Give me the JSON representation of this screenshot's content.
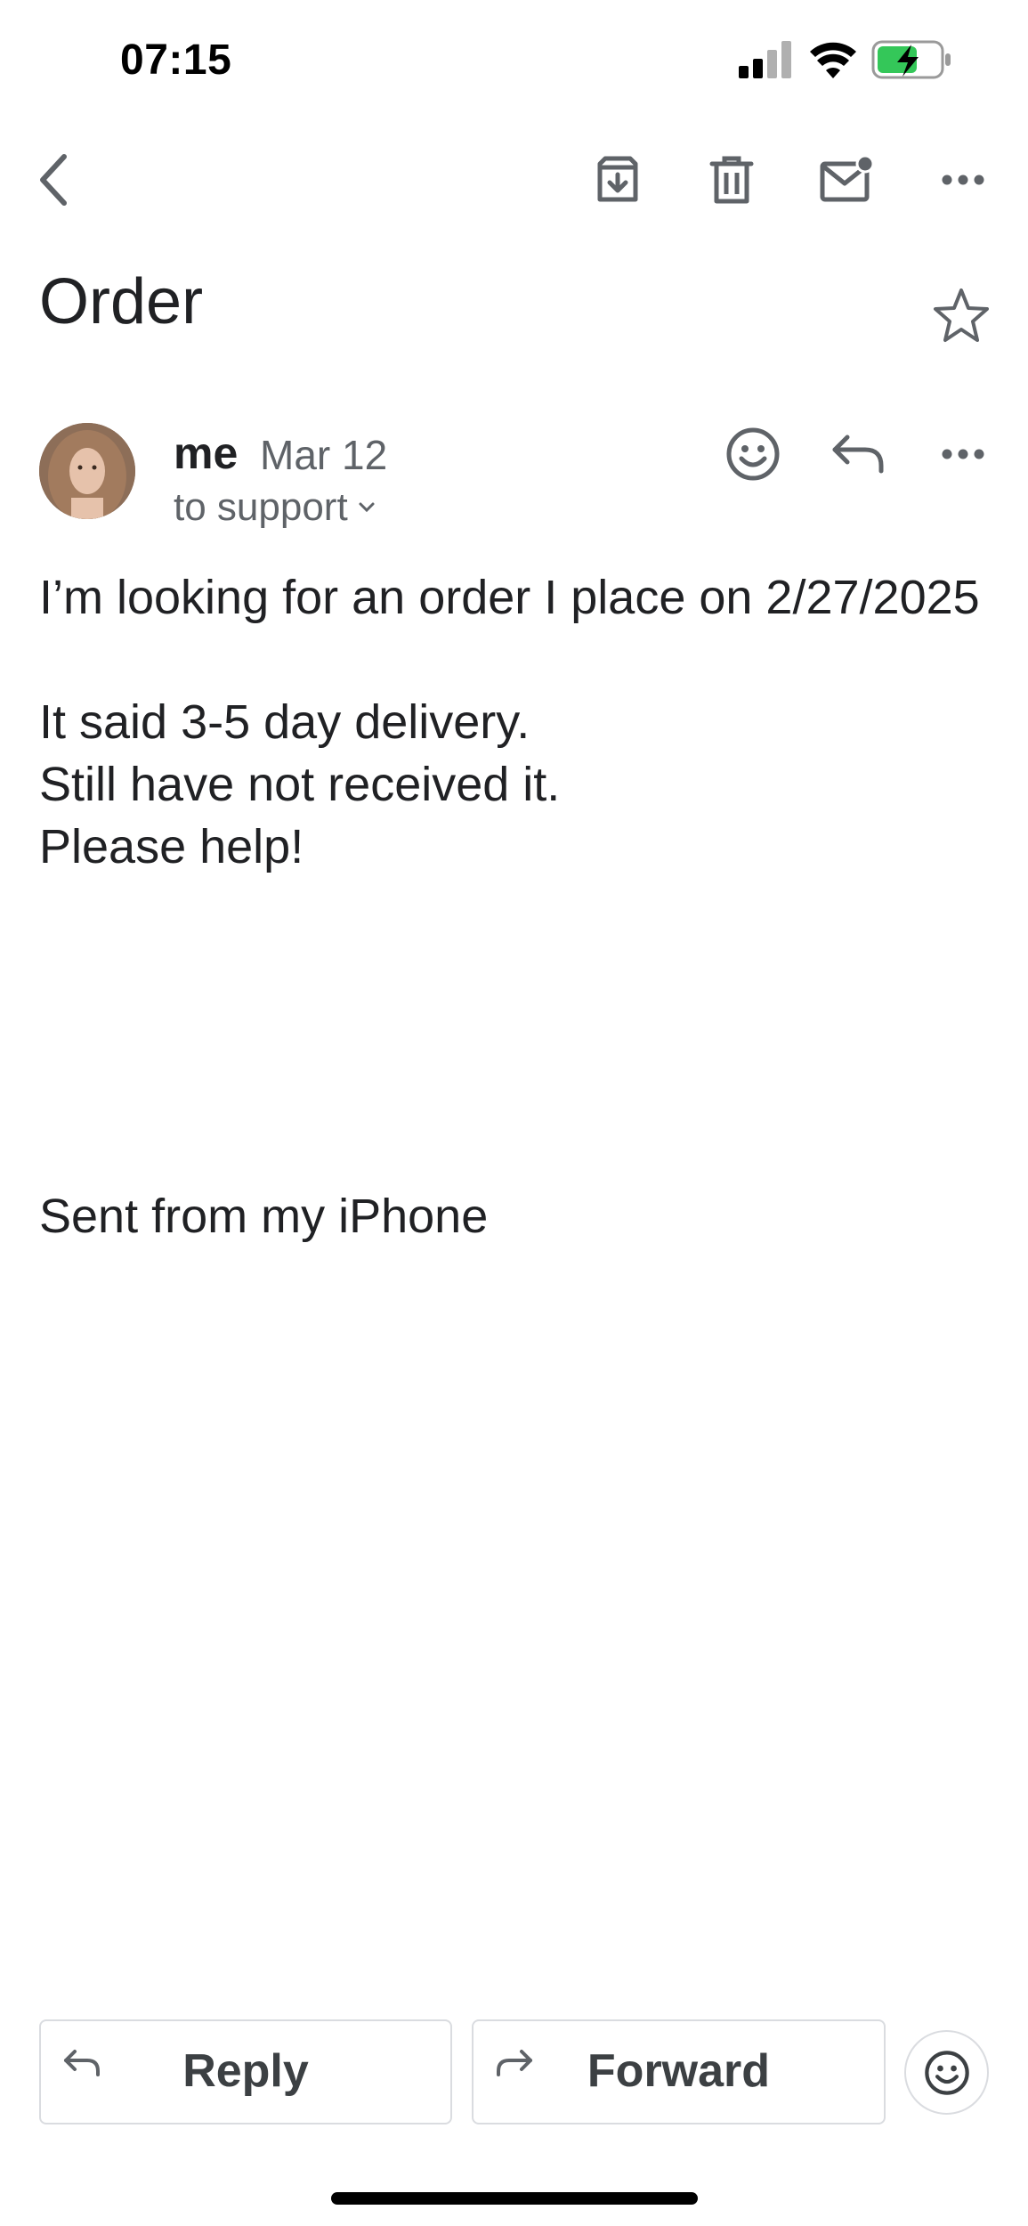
{
  "status_bar": {
    "time": "07:15",
    "icons": [
      "cellular-signal-icon",
      "wifi-icon",
      "battery-charging-icon"
    ],
    "battery_color": "#34c759"
  },
  "toolbar": {
    "icons": [
      "back-icon",
      "archive-icon",
      "delete-icon",
      "mark-unread-icon",
      "more-icon"
    ]
  },
  "email": {
    "subject": "Order",
    "sender": "me",
    "date": "Mar 12",
    "recipient": "to support",
    "body": [
      "I’m looking for an order I place on 2/27/2025",
      "It said 3-5 day delivery.",
      "Still have not received it.",
      "Please help!"
    ],
    "signature": "Sent from my iPhone"
  },
  "actions": {
    "reply_label": "Reply",
    "forward_label": "Forward"
  }
}
